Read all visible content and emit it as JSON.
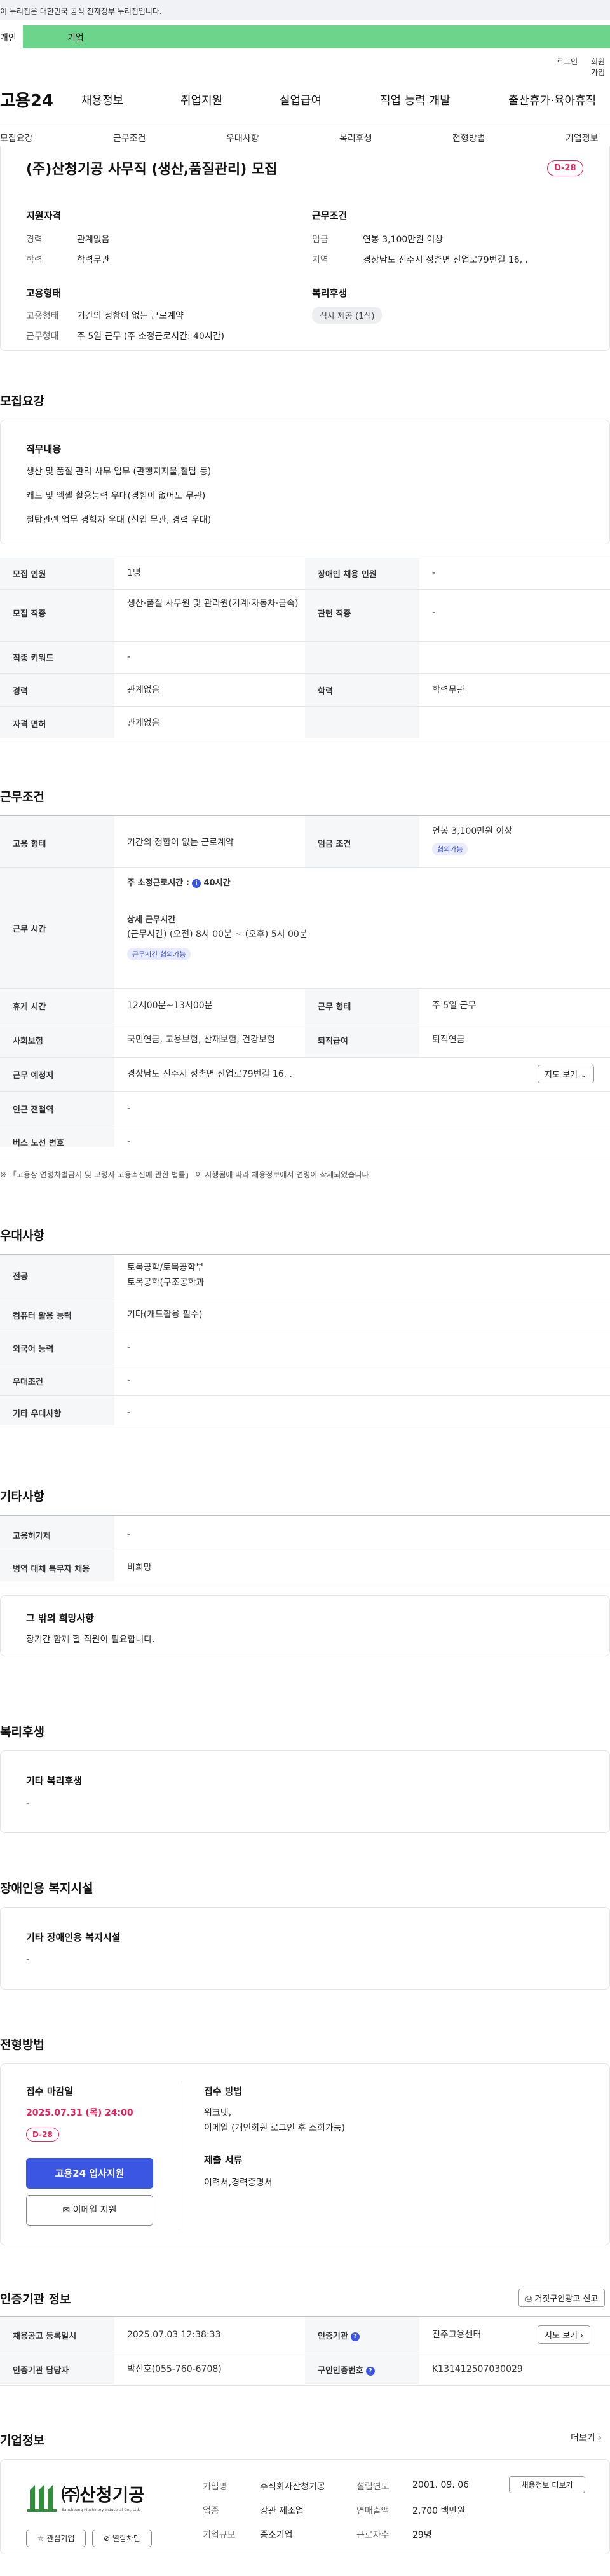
{
  "gov_bar": {
    "text": "이 누리집은 대한민국 공식 전자정부 누리집입니다."
  },
  "tabs": {
    "person": "개인",
    "company": "기업"
  },
  "util": {
    "login": "로그인",
    "join": "회원가입"
  },
  "gnb": {
    "logo": "고용24",
    "items": [
      "채용정보",
      "취업지원",
      "실업급여",
      "직업 능력 개발",
      "출산휴가·육아휴직"
    ]
  },
  "subnav": [
    "모집요강",
    "근무조건",
    "우대사항",
    "복리후생",
    "전형방법",
    "기업정보"
  ],
  "summary": {
    "title": "(주)산청기공 사무직 (생산,품질관리) 모집",
    "dday": "D-28",
    "qual_title": "지원자격",
    "qual": [
      {
        "label": "경력",
        "value": "관계없음"
      },
      {
        "label": "학력",
        "value": "학력무관"
      }
    ],
    "cond_title": "근무조건",
    "cond": [
      {
        "label": "임금",
        "value": "연봉 3,100만원 이상"
      },
      {
        "label": "지역",
        "value": "경상남도 진주시 정촌면 산업로79번길 16, ."
      }
    ],
    "type_title": "고용형태",
    "type": [
      {
        "label": "고용형태",
        "value": "기간의 정함이 없는 근로계약"
      },
      {
        "label": "근무형태",
        "value": "주 5일 근무 (주 소정근로시간: 40시간)"
      }
    ],
    "welfare_title": "복리후생",
    "welfare_chip": "식사 제공 (1식)"
  },
  "recruit": {
    "title": "모집요강",
    "job_title": "직무내용",
    "job_lines": [
      "생산 및 품질 관리 사무 업무 (관행지지물,철탑 등)",
      "캐드 및 엑셀 활용능력 우대(경험이 없어도 무관)",
      "철탑관련 업무 경험자 우대 (신입 무관, 경력 우대)"
    ],
    "rows": [
      {
        "h1": "모집 인원",
        "v1": "1명",
        "h2": "장애인 채용 인원",
        "v2": "-"
      },
      {
        "h1": "모집 직종",
        "v1": "생산·품질 사무원 및 관리원(기계·자동차·금속)",
        "h2": "관련 직종",
        "v2": "-"
      },
      {
        "h1": "직종 키워드",
        "v1": "-",
        "h2": "",
        "v2": ""
      },
      {
        "h1": "경력",
        "v1": "관계없음",
        "h2": "학력",
        "v2": "학력무관"
      },
      {
        "h1": "자격 면허",
        "v1": "관계없음",
        "h2": "",
        "v2": ""
      }
    ]
  },
  "work": {
    "title": "근무조건",
    "emp_h": "고용 형태",
    "emp_v": "기간의 정함이 없는 근로계약",
    "wage_h": "임금 조건",
    "wage_v": "연봉 3,100만원 이상",
    "wage_chip": "협의가능",
    "hours_h": "근무 시간",
    "hours_main": "주 소정근로시간 :",
    "hours_val": "40시간",
    "hours_detail_title": "상세 근무시간",
    "hours_detail": "(근무시간) (오전) 8시 00분 ~ (오후) 5시 00분",
    "hours_chip": "근무시간 협의가능",
    "rest_h": "휴게 시간",
    "rest_v": "12시00분~13시00분",
    "form_h": "근무 형태",
    "form_v": "주 5일 근무",
    "ins_h": "사회보험",
    "ins_v": "국민연금, 고용보험, 산재보험, 건강보험",
    "retire_h": "퇴직급여",
    "retire_v": "퇴직연금",
    "loc_h": "근무 예정지",
    "loc_v": "경상남도 진주시 정촌면 산업로79번길 16, .",
    "map_btn": "지도 보기",
    "subway_h": "인근 전철역",
    "subway_v": "-",
    "bus_h": "버스 노선 번호",
    "bus_v": "-",
    "note": "※ 「고용상 연령차별금지 및 고령자 고용촉진에 관한 법률」 이 시행됨에 따라 채용정보에서 연령이 삭제되었습니다."
  },
  "pref": {
    "title": "우대사항",
    "rows": [
      {
        "h": "전공",
        "v": [
          "토목공학/토목공학부",
          "토목공학(구조공학과"
        ]
      },
      {
        "h": "컴퓨터 활용 능력",
        "v": [
          "기타(캐드활용 필수)"
        ]
      },
      {
        "h": "외국어 능력",
        "v": [
          "-"
        ]
      },
      {
        "h": "우대조건",
        "v": [
          "-"
        ]
      },
      {
        "h": "기타 우대사항",
        "v": [
          "-"
        ]
      }
    ]
  },
  "etc": {
    "title": "기타사항",
    "rows": [
      {
        "h": "고용허가제",
        "v": "-"
      },
      {
        "h": "병역 대체 복무자 채용",
        "v": "비희망"
      }
    ],
    "box_title": "그 밖의 희망사항",
    "box_text": "장기간 함께 할 직원이 필요합니다."
  },
  "welfare": {
    "title": "복리후생",
    "box_title": "기타 복리후생",
    "box_text": "-"
  },
  "disability": {
    "title": "장애인용 복지시설",
    "box_title": "기타 장애인용 복지시설",
    "box_text": "-"
  },
  "process": {
    "title": "전형방법",
    "deadline_h": "접수 마감일",
    "deadline_v": "2025.07.31 (목) 24:00",
    "dday": "D-28",
    "apply_btn": "고용24 입사지원",
    "email_btn": "이메일 지원",
    "method_h": "접수 방법",
    "method_v": [
      "워크넷,",
      "이메일 (개인회원 로그인 후 조회가능)"
    ],
    "docs_h": "제출 서류",
    "docs_v": "이력서,경력증명서"
  },
  "cert": {
    "title": "인증기관 정보",
    "report_btn": "거짓구인광고 신고",
    "rows": [
      {
        "h1": "채용공고 등록일시",
        "v1": "2025.07.03 12:38:33",
        "h2": "인증기관",
        "v2": "진주고용센터"
      },
      {
        "h1": "인증기관 담당자",
        "v1": "박신호(055-760-6708)",
        "h2": "구인인증번호",
        "v2": "K131412507030029"
      }
    ],
    "map_btn": "지도 보기"
  },
  "company": {
    "title": "기업정보",
    "more": "더보기",
    "logo_text": "㈜산청기공",
    "logo_sub": "Sancheong Machinery Industrial Co., Ltd.",
    "fav_btn": "관심기업",
    "block_btn": "열람차단",
    "info": [
      {
        "h": "기업명",
        "v": "주식회사산청기공"
      },
      {
        "h": "업종",
        "v": "강관 제조업"
      },
      {
        "h": "기업규모",
        "v": "중소기업"
      }
    ],
    "info2": [
      {
        "h": "설립연도",
        "v": "2001. 09. 06"
      },
      {
        "h": "연매출액",
        "v": "2,700 백만원"
      },
      {
        "h": "근로자수",
        "v": "29명"
      }
    ],
    "jobs_btn": "채용정보 더보기"
  }
}
